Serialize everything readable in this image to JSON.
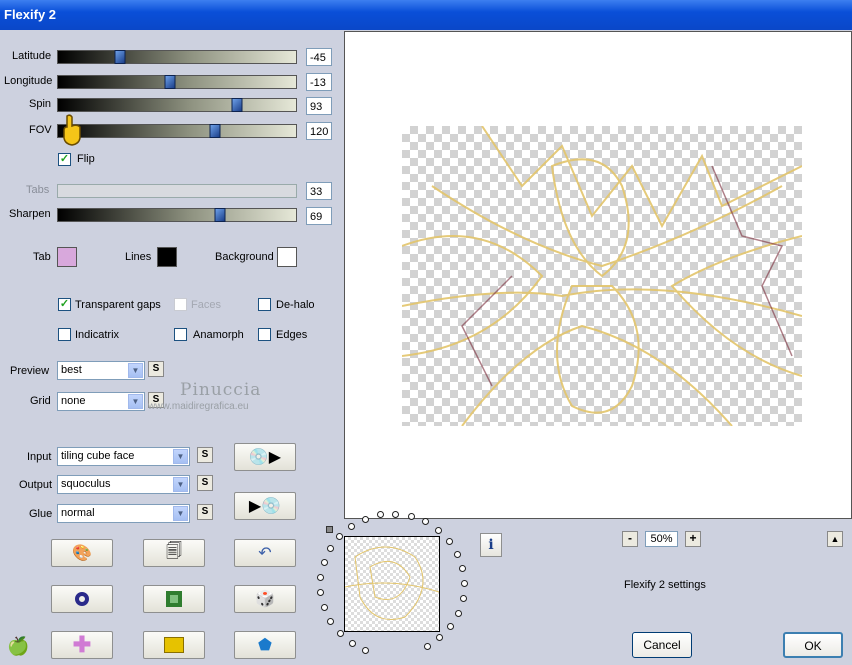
{
  "window": {
    "title": "Flexify 2"
  },
  "sliders": [
    {
      "label": "Latitude",
      "value": "-45",
      "fraction": 0.26
    },
    {
      "label": "Longitude",
      "value": "-13",
      "fraction": 0.47
    },
    {
      "label": "Spin",
      "value": "93",
      "fraction": 0.75
    },
    {
      "label": "FOV",
      "value": "120",
      "fraction": 0.66
    },
    {
      "label": "Tabs",
      "value": "33",
      "disabled": true
    },
    {
      "label": "Sharpen",
      "value": "69",
      "fraction": 0.68
    }
  ],
  "flip": {
    "label": "Flip",
    "checked": true
  },
  "colors": {
    "tab_label": "Tab",
    "tab_color": "#d8a8dc",
    "lines_label": "Lines",
    "lines_color": "#000000",
    "background_label": "Background",
    "background_color": "#ffffff"
  },
  "options": {
    "transparent_gaps": {
      "label": "Transparent gaps",
      "checked": true
    },
    "faces": {
      "label": "Faces",
      "checked": false,
      "disabled": true
    },
    "de_halo": {
      "label": "De-halo",
      "checked": false
    },
    "indicatrix": {
      "label": "Indicatrix",
      "checked": false
    },
    "anamorph": {
      "label": "Anamorph",
      "checked": false
    },
    "edges": {
      "label": "Edges",
      "checked": false
    }
  },
  "preview_select": {
    "label": "Preview",
    "value": "best"
  },
  "grid_select": {
    "label": "Grid",
    "value": "none"
  },
  "input_select": {
    "label": "Input",
    "value": "tiling cube face"
  },
  "output_select": {
    "label": "Output",
    "value": "squoculus"
  },
  "glue_select": {
    "label": "Glue",
    "value": "normal"
  },
  "s_label": "S",
  "watermark": {
    "name": "Pinuccia",
    "url": "www.maidiregrafica.eu"
  },
  "zoom": {
    "minus": "-",
    "value": "50%",
    "plus": "+"
  },
  "settings_label": "Flexify 2 settings",
  "buttons": {
    "cancel": "Cancel",
    "ok": "OK"
  },
  "info_icon": "i",
  "accent": "#0a4fd8"
}
